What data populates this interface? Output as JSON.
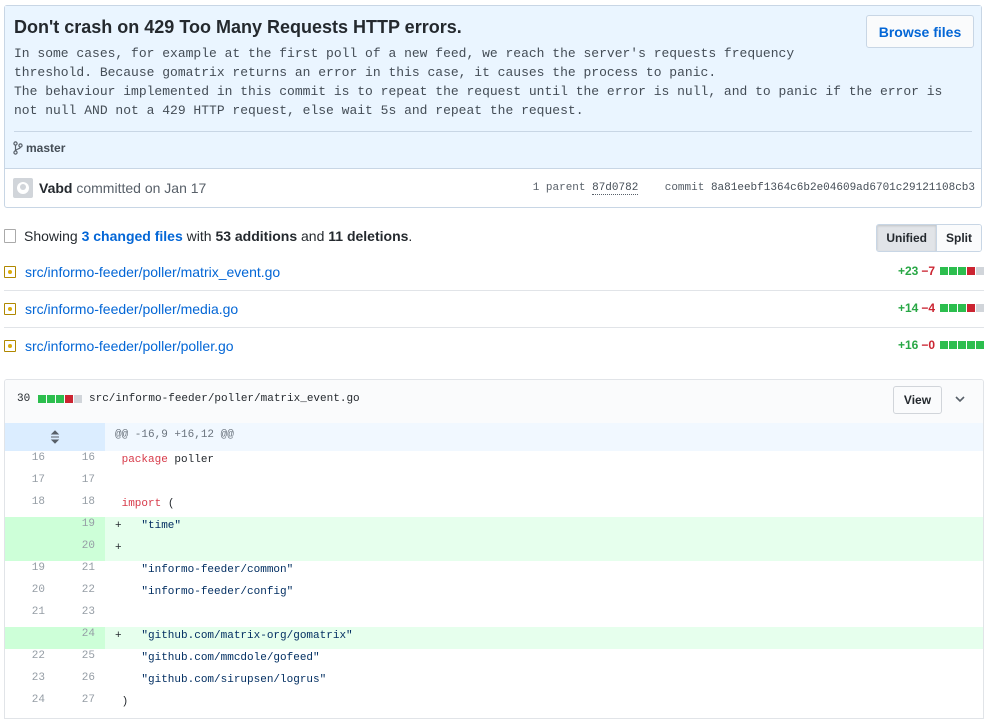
{
  "commit": {
    "title": "Don't crash on 429 Too Many Requests HTTP errors.",
    "description": "In some cases, for example at the first poll of a new feed, we reach the server's requests frequency\nthreshold. Because gomatrix returns an error in this case, it causes the process to panic.\nThe behaviour implemented in this commit is to repeat the request until the error is null, and to panic if the error is\nnot null AND not a 429 HTTP request, else wait 5s and repeat the request.",
    "browse_label": "Browse files",
    "branch": "master",
    "author": "Vabd",
    "committed_text": "committed on Jan 17",
    "parent_label": "1 parent",
    "parent_sha": "87d0782",
    "commit_label": "commit",
    "commit_sha": "8a81eebf1364c6b2e04609ad6701c29121108cb3"
  },
  "summary": {
    "showing": "Showing",
    "changed_files": "3 changed files",
    "with": "with",
    "additions": "53 additions",
    "and": "and",
    "deletions": "11 deletions",
    "period": ".",
    "unified": "Unified",
    "split": "Split"
  },
  "files": [
    {
      "path": "src/informo-feeder/poller/matrix_event.go",
      "add": "+23",
      "del": "−7"
    },
    {
      "path": "src/informo-feeder/poller/media.go",
      "add": "+14",
      "del": "−4"
    },
    {
      "path": "src/informo-feeder/poller/poller.go",
      "add": "+16",
      "del": "−0"
    }
  ],
  "diff": {
    "count": "30",
    "path": "src/informo-feeder/poller/matrix_event.go",
    "view_label": "View",
    "hunk": "@@ -16,9 +16,12 @@",
    "lines": [
      {
        "old": "16",
        "new": "16",
        "type": "ctx",
        "text": " package poller"
      },
      {
        "old": "17",
        "new": "17",
        "type": "ctx",
        "text": ""
      },
      {
        "old": "18",
        "new": "18",
        "type": "ctx",
        "text": " import ("
      },
      {
        "old": "",
        "new": "19",
        "type": "add",
        "text": "+   \"time\""
      },
      {
        "old": "",
        "new": "20",
        "type": "add",
        "text": "+"
      },
      {
        "old": "19",
        "new": "21",
        "type": "ctx",
        "text": "    \"informo-feeder/common\""
      },
      {
        "old": "20",
        "new": "22",
        "type": "ctx",
        "text": "    \"informo-feeder/config\""
      },
      {
        "old": "21",
        "new": "23",
        "type": "ctx",
        "text": ""
      },
      {
        "old": "",
        "new": "24",
        "type": "add",
        "text": "+   \"github.com/matrix-org/gomatrix\""
      },
      {
        "old": "22",
        "new": "25",
        "type": "ctx",
        "text": "    \"github.com/mmcdole/gofeed\""
      },
      {
        "old": "23",
        "new": "26",
        "type": "ctx",
        "text": "    \"github.com/sirupsen/logrus\""
      },
      {
        "old": "24",
        "new": "27",
        "type": "ctx",
        "text": " )"
      }
    ]
  },
  "colors": {
    "accent": "#0366d6",
    "add": "#28a745",
    "del": "#cb2431",
    "header_bg": "#eaf5ff"
  }
}
